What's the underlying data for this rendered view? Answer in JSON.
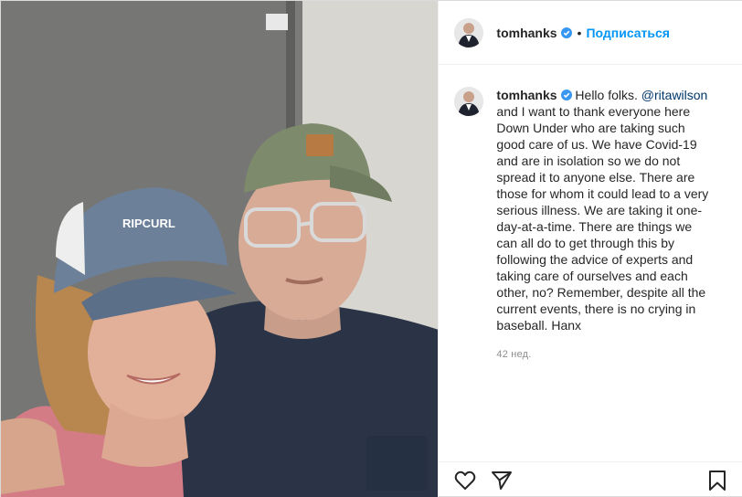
{
  "post": {
    "photo_alt_icon": "selfie-photo",
    "header": {
      "username": "tomhanks",
      "verified_icon": "verified-badge-icon",
      "separator": "•",
      "follow_label": "Подписаться"
    },
    "caption": {
      "username": "tomhanks",
      "text_before_mention": "Hello folks. ",
      "mention": "@ritawilson",
      "text_after_mention": " and I want to thank everyone here Down Under who are taking such good care of us. We have Covid-19 and are in isolation so we do not spread it to anyone else. There are those for whom it could lead to a very serious illness. We are taking it one-day-at-a-time. There are things we can all do to get through this by following the advice of experts and taking care of ourselves and each other, no? Remember, despite all the current events, there is no crying in baseball. Hanx",
      "time": "42 нед."
    },
    "actions": {
      "like_icon": "heart-icon",
      "share_icon": "paper-plane-icon",
      "save_icon": "bookmark-icon"
    },
    "colors": {
      "follow": "#0095f6",
      "mention": "#00376b",
      "verified": "#3897f0",
      "muted": "#8e8e8e"
    }
  }
}
